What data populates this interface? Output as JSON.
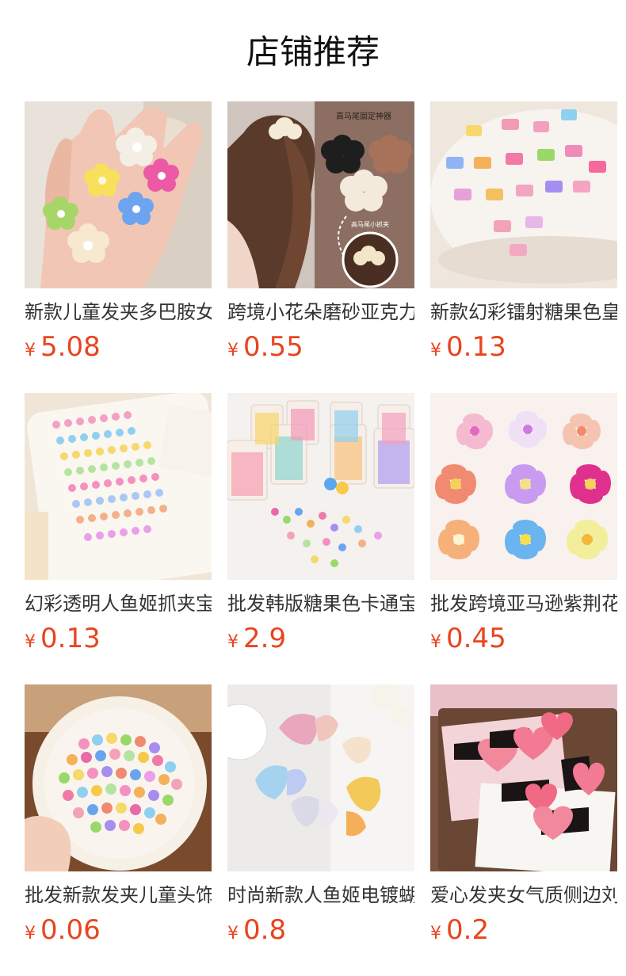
{
  "header": {
    "title": "店铺推荐"
  },
  "currency_symbol": "¥",
  "colors": {
    "price": "#e8451f",
    "title": "#111111",
    "name": "#333333"
  },
  "products": [
    {
      "name": "新款儿童发夹多巴胺女",
      "price": "5.08",
      "image_icon": "flower-clips-in-hand-image"
    },
    {
      "name": "跨境小花朵磨砂亚克力",
      "price": "0.55",
      "image_icon": "ponytail-flower-claw-image",
      "image_text": [
        "高马尾固定神器",
        "高马尾小抓夹"
      ]
    },
    {
      "name": "新款幻彩镭射糖果色皇",
      "price": "0.13",
      "image_icon": "crown-clips-on-plate-image"
    },
    {
      "name": "幻彩透明人鱼姬抓夹宝",
      "price": "0.13",
      "image_icon": "mini-claw-rows-image"
    },
    {
      "name": "批发韩版糖果色卡通宝",
      "price": "2.9",
      "image_icon": "boxed-candy-clips-image"
    },
    {
      "name": "批发跨境亚马逊紫荆花",
      "price": "0.45",
      "image_icon": "plumeria-flower-claws-image"
    },
    {
      "name": "批发新款发夹儿童头饰",
      "price": "0.06",
      "image_icon": "plate-of-mini-clips-image"
    },
    {
      "name": "时尚新款人鱼姬电镀蝴",
      "price": "0.8",
      "image_icon": "butterfly-claw-clips-image"
    },
    {
      "name": "爱心发夹女气质侧边刘",
      "price": "0.2",
      "image_icon": "heart-side-clips-image"
    }
  ]
}
